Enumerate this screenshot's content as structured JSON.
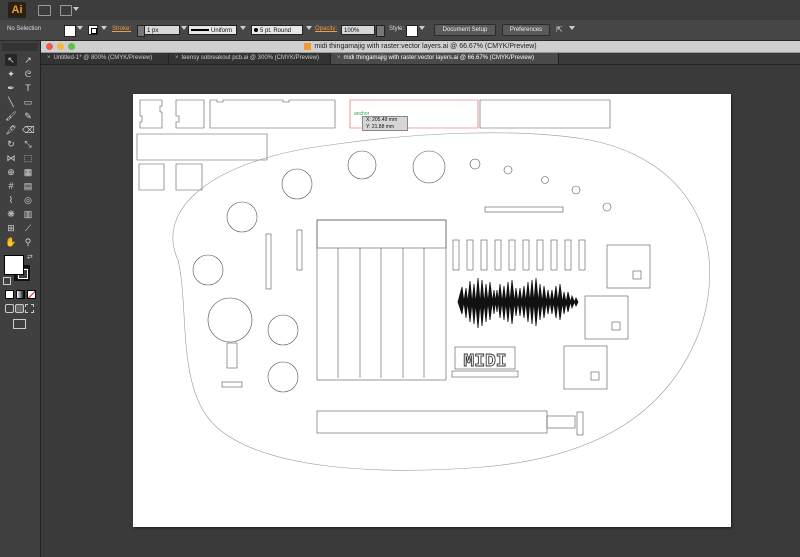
{
  "app": {
    "logo": "Ai",
    "title_icon": "bridge-icon",
    "workspace_icon": "arrange-documents-icon"
  },
  "control_bar": {
    "selection_label": "No Selection",
    "stroke_label": "Stroke:",
    "stroke_weight": "1 px",
    "profile_value": "Uniform",
    "brush_value": "5 pt. Round",
    "opacity_label": "Opacity:",
    "opacity_value": "100%",
    "style_label": "Style:",
    "document_setup_label": "Document Setup",
    "preferences_label": "Preferences"
  },
  "document": {
    "title": "midi thingamajig with raster:vector layers.ai @ 66.67% (CMYK/Preview)",
    "tabs": [
      {
        "label": "Untitled-1* @ 800% (CMYK/Preview)",
        "active": false
      },
      {
        "label": "teensy sobreakout pcb.ai @ 300% (CMYK/Preview)",
        "active": false
      },
      {
        "label": "midi thingamajig with raster:vector layers.ai @ 66.67% (CMYK/Preview)",
        "active": true
      }
    ],
    "close_symbol": "×"
  },
  "canvas": {
    "cursor_readout_x": "X: 205.49 mm",
    "cursor_readout_y": "Y: 21.88 mm",
    "smart_guide_label": "anchor",
    "artwork_text": "MIDI"
  },
  "tools": [
    {
      "name": "selection-tool-icon",
      "glyph": "↖"
    },
    {
      "name": "direct-selection-tool-icon",
      "glyph": "↗"
    },
    {
      "name": "magic-wand-tool-icon",
      "glyph": "✦"
    },
    {
      "name": "lasso-tool-icon",
      "glyph": "ᘓ"
    },
    {
      "name": "pen-tool-icon",
      "glyph": "✒"
    },
    {
      "name": "type-tool-icon",
      "glyph": "T"
    },
    {
      "name": "line-tool-icon",
      "glyph": "╲"
    },
    {
      "name": "rectangle-tool-icon",
      "glyph": "▭"
    },
    {
      "name": "paintbrush-tool-icon",
      "glyph": "🖌"
    },
    {
      "name": "pencil-tool-icon",
      "glyph": "✎"
    },
    {
      "name": "blob-brush-tool-icon",
      "glyph": "🖋"
    },
    {
      "name": "eraser-tool-icon",
      "glyph": "⌫"
    },
    {
      "name": "rotate-tool-icon",
      "glyph": "↻"
    },
    {
      "name": "scale-tool-icon",
      "glyph": "⤡"
    },
    {
      "name": "width-tool-icon",
      "glyph": "⋈"
    },
    {
      "name": "free-transform-tool-icon",
      "glyph": "⬚"
    },
    {
      "name": "shape-builder-tool-icon",
      "glyph": "⊕"
    },
    {
      "name": "perspective-grid-tool-icon",
      "glyph": "▦"
    },
    {
      "name": "mesh-tool-icon",
      "glyph": "#"
    },
    {
      "name": "gradient-tool-icon",
      "glyph": "▤"
    },
    {
      "name": "eyedropper-tool-icon",
      "glyph": "⌇"
    },
    {
      "name": "blend-tool-icon",
      "glyph": "◎"
    },
    {
      "name": "symbol-sprayer-tool-icon",
      "glyph": "❋"
    },
    {
      "name": "column-graph-tool-icon",
      "glyph": "▥"
    },
    {
      "name": "artboard-tool-icon",
      "glyph": "⊞"
    },
    {
      "name": "slice-tool-icon",
      "glyph": "⟋"
    },
    {
      "name": "hand-tool-icon",
      "glyph": "✋"
    },
    {
      "name": "zoom-tool-icon",
      "glyph": "⚲"
    }
  ]
}
